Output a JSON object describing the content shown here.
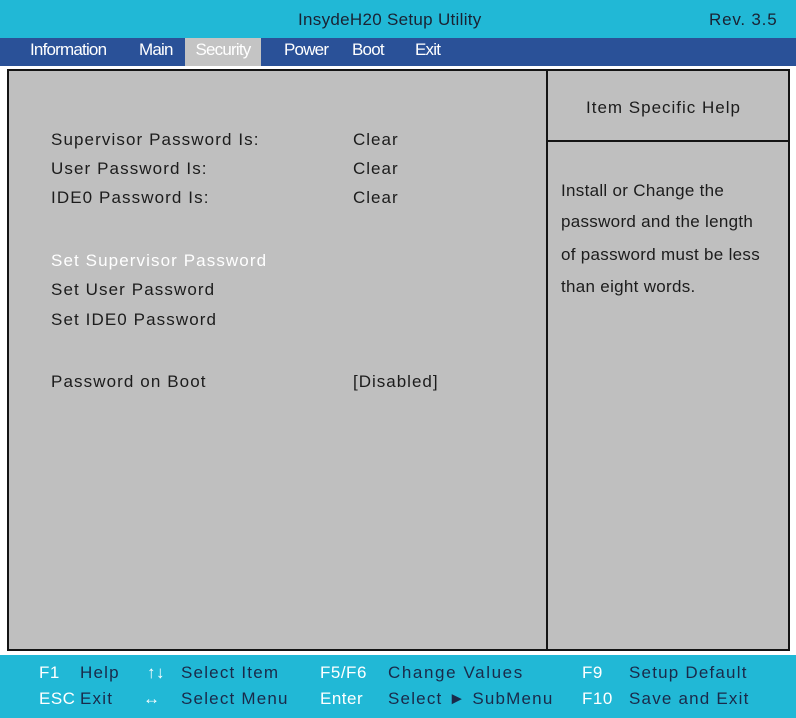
{
  "window": {
    "title": "InsydeH20 Setup Utility",
    "revision": "Rev. 3.5"
  },
  "menu": {
    "items": [
      {
        "label": "Information"
      },
      {
        "label": "Main"
      },
      {
        "label": "Security"
      },
      {
        "label": "Power"
      },
      {
        "label": "Boot"
      },
      {
        "label": "Exit"
      }
    ],
    "active": "Security"
  },
  "security": {
    "status": [
      {
        "label": "Supervisor Password Is:",
        "value": "Clear"
      },
      {
        "label": "User Password Is:",
        "value": "Clear"
      },
      {
        "label": "IDE0 Password Is:",
        "value": "Clear"
      }
    ],
    "actions": [
      {
        "label": "Set Supervisor Password",
        "selected": true
      },
      {
        "label": "Set User Password",
        "selected": false
      },
      {
        "label": "Set IDE0 Password",
        "selected": false
      }
    ],
    "password_on_boot": {
      "label": "Password on Boot",
      "value": "[Disabled]"
    }
  },
  "help": {
    "title": "Item Specific Help",
    "lines": [
      "Install or Change the",
      "password and the length",
      "of password must be less",
      "than eight words."
    ]
  },
  "footer": {
    "row1": [
      {
        "key": "F1",
        "desc": "Help"
      },
      {
        "key": "↑↓",
        "desc": "Select  Item"
      },
      {
        "key": "F5/F6",
        "desc": "Change  Values"
      },
      {
        "key": "F9",
        "desc": "Setup  Default"
      }
    ],
    "row2": [
      {
        "key": "ESC",
        "desc": "Exit"
      },
      {
        "key": "↔",
        "desc": "Select  Menu"
      },
      {
        "key": "Enter",
        "desc": "Select ► SubMenu"
      },
      {
        "key": "F10",
        "desc": "Save  and  Exit"
      }
    ]
  },
  "colors": {
    "title_bar": "#21b8d6",
    "menu_bar": "#2a5198",
    "panel": "#bfbfbf",
    "highlight_text": "#ffffff"
  }
}
